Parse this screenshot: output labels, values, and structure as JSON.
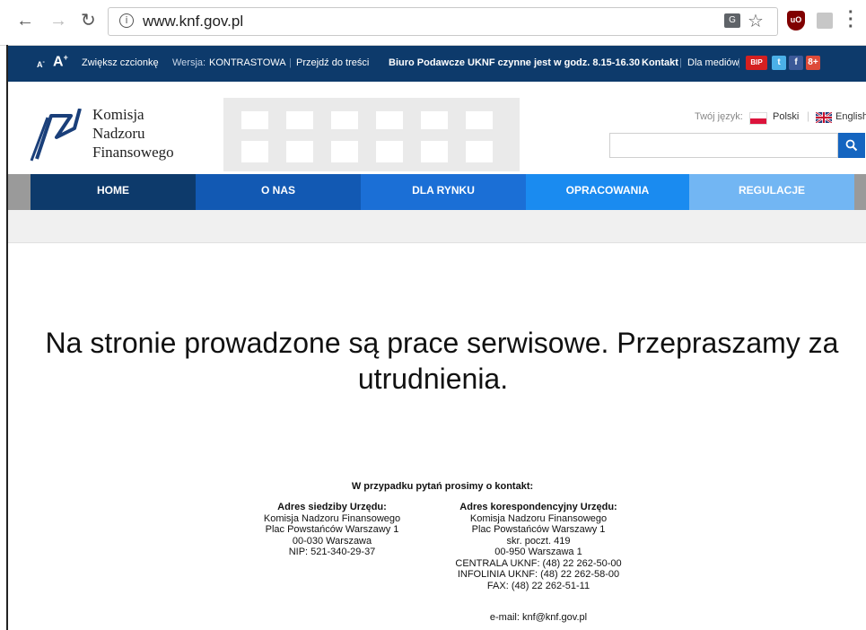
{
  "browser": {
    "url": "www.knf.gov.pl",
    "back_icon": "arrow-left-icon",
    "forward_icon": "arrow-right-icon",
    "reload_icon": "reload-icon"
  },
  "topbar": {
    "font_small": "A",
    "font_small_sup": "-",
    "font_large": "A",
    "font_large_sup": "+",
    "increase_font": "Zwiększ czcionkę",
    "version_label": "Wersja:",
    "version_value": "KONTRASTOWA",
    "skip_link": "Przejdź do treści",
    "office_hours": "Biuro Podawcze UKNF czynne jest w godz. 8.15-16.30",
    "contact": "Kontakt",
    "media": "Dla mediów",
    "social": [
      "BIP",
      "t",
      "f",
      "8+"
    ]
  },
  "header": {
    "logo_lines": [
      "Komisja",
      "Nadzoru",
      "Finansowego"
    ],
    "lang_label": "Twój język:",
    "lang_pl": "Polski",
    "lang_en": "English",
    "search_placeholder": ""
  },
  "nav": {
    "items": [
      {
        "label": "HOME",
        "color": "#0d3a6b"
      },
      {
        "label": "O NAS",
        "color": "#1259b3"
      },
      {
        "label": "DLA RYNKU",
        "color": "#1b6fd6"
      },
      {
        "label": "OPRACOWANIA",
        "color": "#1a8bf0"
      },
      {
        "label": "REGULACJE",
        "color": "#72b6f3"
      }
    ]
  },
  "main": {
    "message_line1": "Na stronie prowadzone są prace serwisowe. Przepraszamy za",
    "message_line2": "utrudnienia.",
    "contact_heading": "W przypadku pytań prosimy o kontakt:",
    "hq": {
      "title": "Adres siedziby Urzędu:",
      "lines": [
        "Komisja Nadzoru Finansowego",
        "Plac Powstańców Warszawy 1",
        "00-030 Warszawa",
        "NIP: 521-340-29-37"
      ]
    },
    "corr": {
      "title": "Adres korespondencyjny Urzędu:",
      "lines": [
        "Komisja Nadzoru Finansowego",
        "Plac Powstańców Warszawy 1",
        "skr. poczt. 419",
        "00-950 Warszawa 1",
        "CENTRALA UKNF: (48) 22 262-50-00",
        "INFOLINIA UKNF: (48) 22 262-58-00",
        "FAX: (48) 22 262-51-11"
      ]
    },
    "email": "e-mail: knf@knf.gov.pl"
  }
}
